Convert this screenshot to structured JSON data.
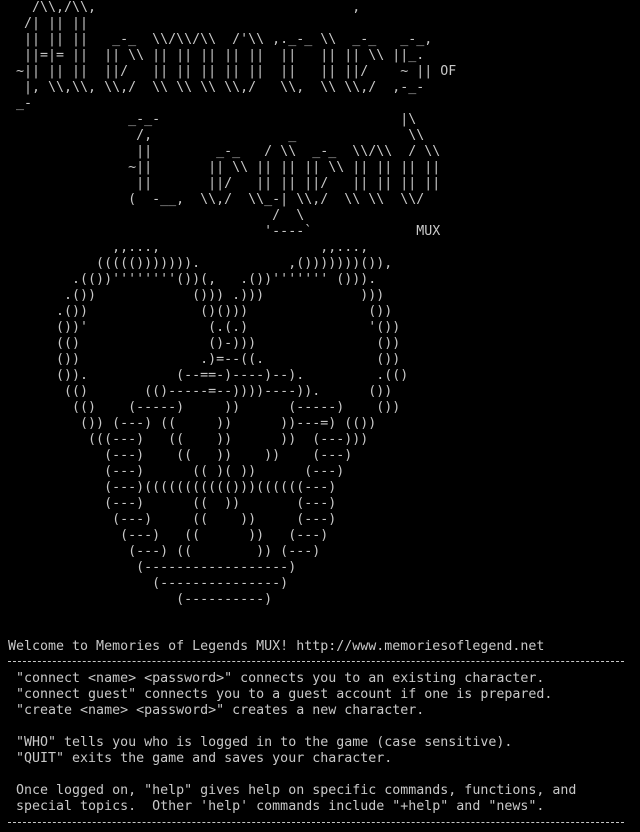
{
  "app": {
    "window_title": "Memories of Legends MUX"
  },
  "banner": {
    "art_lines": [
      "   /\\\\,/\\\\,                                ,",
      "  /| || ||                               ",
      "  || || ||   _-_  \\\\/\\\\/\\\\  /'\\\\ ,._-_ \\\\  _-_   _-_,",
      "  ||=|= ||  || \\\\ || || || || ||  ||   || || \\\\ ||_.",
      " ~|| || ||  ||/   || || || || ||  ||   || ||/    ~ || OF",
      "  |, \\\\,\\\\, \\\\,/  \\\\ \\\\ \\\\ \\\\,/   \\\\,  \\\\ \\\\,/  ,-_-",
      " _-",
      "               _-_-                              |\\",
      "                /,                 _              \\\\",
      "                ||        _-_   / \\\\  _-_  \\\\/\\\\  / \\\\",
      "               ~||       || \\\\ || || || \\\\ || || || ||",
      "                ||       ||/   || || ||/   || || || ||",
      "               (  -__,  \\\\,/  \\\\_-| \\\\,/  \\\\ \\\\  \\\\/",
      "                                 /  \\",
      "                                '----`             MUX",
      "             ,,...,                    ,,...,",
      "           ((((())))))).           ,()))))))()),",
      "        .(())''''''''())(,   .())''''''' ())).",
      "       .())            ())) .)))            )))",
      "      .())              ()()))               ())",
      "      ())'               (.(.)               '())",
      "      (()                ()-)))               ())",
      "      ())               .)=--((.              ())",
      "      ()).           (--==-)----)--).         .(()",
      "       (()       (()-----=--))))----)).      ())",
      "        (()    (-----)     ))      (-----)    ())",
      "         ()) (---) ((     ))      ))---=) (())",
      "          (((---)   ((    ))      ))  (---)))",
      "            (---)    ((   ))    ))    (---)",
      "            (---)      (( )( ))      (---)",
      "            (---)((((((((((()))((((((---)",
      "            (---)      ((  ))       (---)",
      "             (---)     ((    ))     (---)",
      "              (---)   ((      ))   (---)",
      "               (---) ((        )) (---)",
      "                (------------------)",
      "                  (---------------)",
      "                     (----------)"
    ]
  },
  "welcome": {
    "text": "Welcome to Memories of Legends MUX! http://www.memoriesoflegend.net"
  },
  "instructions": {
    "lines": [
      " \"connect <name> <password>\" connects you to an existing character.",
      " \"connect guest\" connects you to a guest account if one is prepared.",
      " \"create <name> <password>\" creates a new character.",
      "",
      " \"WHO\" tells you who is logged in to the game (case sensitive).",
      " \"QUIT\" exits the game and saves your character.",
      "",
      " Once logged on, \"help\" gives help on specific commands, functions, and",
      " special topics.  Other 'help' commands include \"+help\" and \"news\"."
    ]
  },
  "colors": {
    "background": "#000000",
    "foreground": "#c8c8c8"
  }
}
